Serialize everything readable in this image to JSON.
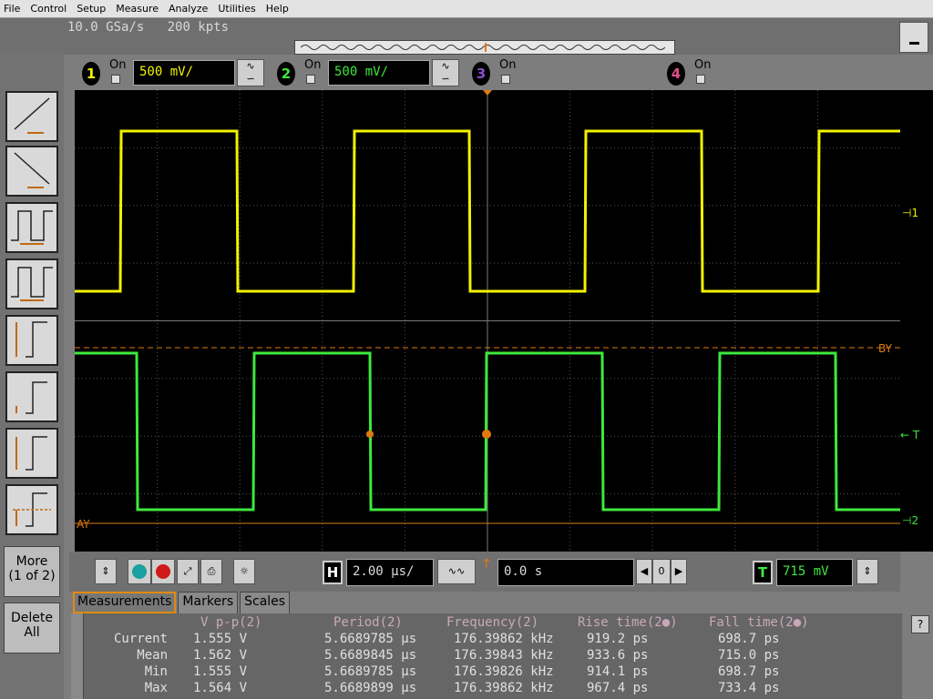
{
  "menu": [
    "File",
    "Control",
    "Setup",
    "Measure",
    "Analyze",
    "Utilities",
    "Help"
  ],
  "acq": {
    "sample_rate": "10.0 GSa/s",
    "points": "200 kpts"
  },
  "channels": [
    {
      "num": "1",
      "on_label": "On",
      "scale": "500 mV/",
      "color": "#f2f200",
      "number_color": "#f2f200"
    },
    {
      "num": "2",
      "on_label": "On",
      "scale": "500 mV/",
      "color": "#3ee83e",
      "number_color": "#3ee83e"
    },
    {
      "num": "3",
      "on_label": "On",
      "scale": "",
      "color": "#8a4fc8",
      "number_color": "#8a4fc8"
    },
    {
      "num": "4",
      "on_label": "On",
      "scale": "",
      "color": "#e0508a",
      "number_color": "#e0508a"
    }
  ],
  "left_toolbar": {
    "more_label": "More\n(1 of 2)",
    "delete_label": "Delete\nAll"
  },
  "markers": {
    "ch1_label": "1",
    "by_label": "BY",
    "t_label": "T",
    "ch2_label": "2",
    "ay_label": "AY"
  },
  "timebase": {
    "h_label": "H",
    "scale": "2.00 μs/",
    "delay": "0.0 s",
    "ref": "0",
    "t_label": "T",
    "trigger_level": "715 mV"
  },
  "tabs": [
    "Measurements",
    "Markers",
    "Scales"
  ],
  "measurements": {
    "headers": [
      "V p-p(2)",
      "Period(2)",
      "Frequency(2)",
      "Rise time(2●)",
      "Fall time(2●)"
    ],
    "rows": [
      {
        "label": "Current",
        "values": [
          "1.555 V",
          "5.6689785 μs",
          "176.39862 kHz",
          "919.2 ps",
          "698.7 ps"
        ]
      },
      {
        "label": "Mean",
        "values": [
          "1.562 V",
          "5.6689845 μs",
          "176.39843 kHz",
          "933.6 ps",
          "715.0 ps"
        ]
      },
      {
        "label": "Min",
        "values": [
          "1.555 V",
          "5.6689785 μs",
          "176.39826 kHz",
          "914.1 ps",
          "698.7 ps"
        ]
      },
      {
        "label": "Max",
        "values": [
          "1.564 V",
          "5.6689899 μs",
          "176.39862 kHz",
          "967.4 ps",
          "733.4 ps"
        ]
      }
    ]
  },
  "help_label": "?",
  "colors": {
    "ch1": "#f2f200",
    "ch2": "#3ee83e",
    "marker": "#e07a10",
    "grid": "#555555"
  }
}
